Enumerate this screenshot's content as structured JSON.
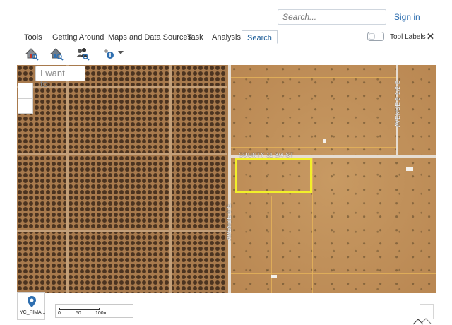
{
  "header": {
    "search_placeholder": "Search...",
    "sign_in": "Sign in"
  },
  "tabs": [
    {
      "label": "Tools"
    },
    {
      "label": "Getting Around"
    },
    {
      "label": "Maps and Data Sources"
    },
    {
      "label": "Task"
    },
    {
      "label": "Analysis"
    },
    {
      "label": "Search",
      "active": true
    }
  ],
  "tool_labels_toggle": {
    "label": "Tool Labels",
    "on": false
  },
  "toolbar": {
    "buttons": [
      {
        "icon": "house-search-icon"
      },
      {
        "icon": "house-search-icon"
      },
      {
        "icon": "people-search-icon"
      },
      {
        "icon": "identify-info-icon"
      }
    ]
  },
  "map": {
    "i_want_to_placeholder": "I want to...",
    "labels": {
      "county": "COUNTY 11 3/4 ST",
      "avenue": "AVENUE 0 E",
      "ave_right": "AVENUE 0 1/2 E"
    },
    "colors": {
      "selection": "#f2f02a",
      "parcel_lines": "#e6b45a"
    }
  },
  "footer": {
    "basemap_label": "YC_PIMA...",
    "scale": {
      "ticks": [
        "0",
        "50",
        "100m"
      ]
    }
  }
}
